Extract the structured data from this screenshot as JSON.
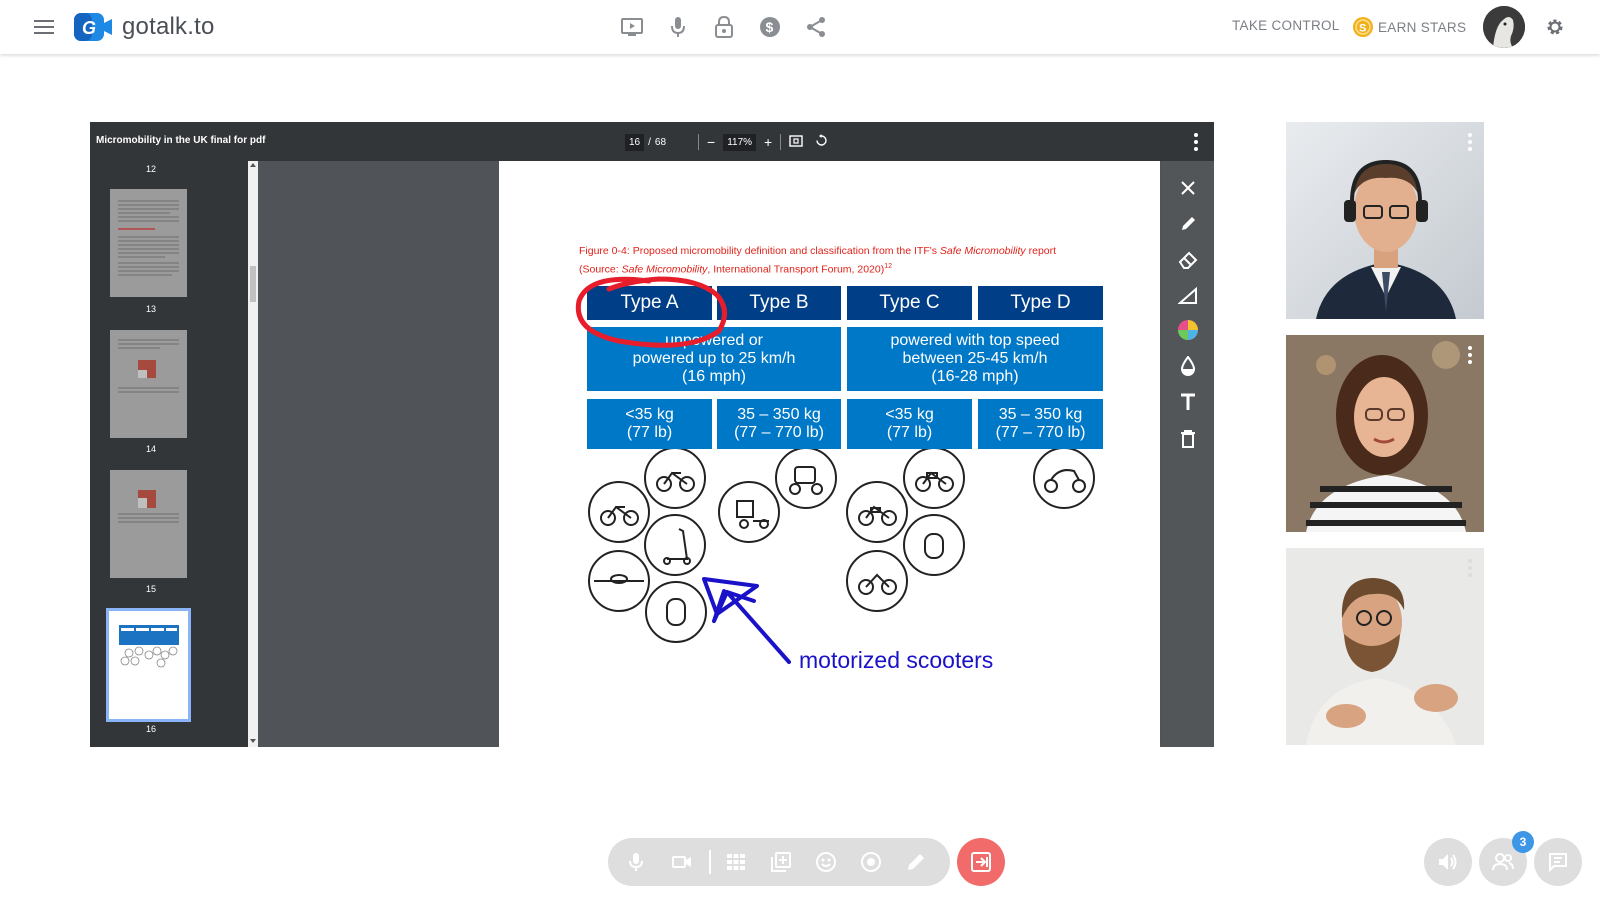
{
  "app": {
    "logo_text": "gotalk.to",
    "take_control_label": "TAKE CONTROL",
    "earn_stars_label": "EARN STARS",
    "colors": {
      "accent": "#1E88E5",
      "coin": "#F2B01E",
      "leave": "#F26B6B",
      "badge": "#3D97E6"
    }
  },
  "viewer": {
    "doc_title": "Micromobility in the UK final for pdf",
    "current_page": "16",
    "page_sep": "/",
    "total_pages": "68",
    "zoom": "117%",
    "thumbnails": [
      {
        "label": "12"
      },
      {
        "label": "13"
      },
      {
        "label": "14"
      },
      {
        "label": "15"
      },
      {
        "label": "16"
      }
    ]
  },
  "page": {
    "caption_line1_prefix": "Figure 0-4: Proposed micromobility definition and classification from the ITF's ",
    "caption_line1_italic": "Safe Micromobility",
    "caption_line1_suffix": " report",
    "caption_line2_prefix": "(Source: ",
    "caption_line2_italic": "Safe Micromobility",
    "caption_line2_suffix": ", International Transport Forum, 2020)",
    "caption_sup": "12",
    "types": [
      "Type A",
      "Type B",
      "Type C",
      "Type D"
    ],
    "speed_left": [
      "unpowered or",
      "powered up to 25 km/h",
      "(16 mph)"
    ],
    "speed_right": [
      "powered with top speed",
      "between 25-45 km/h",
      "(16-28 mph)"
    ],
    "weights": [
      [
        "<35 kg",
        "(77 lb)"
      ],
      [
        "35 – 350 kg",
        "(77 – 770 lb)"
      ],
      [
        "<35 kg",
        "(77 lb)"
      ],
      [
        "35 – 350 kg",
        "(77 – 770 lb)"
      ]
    ],
    "annotation_text": "motorized scooters"
  },
  "participants": {
    "count": "3"
  }
}
